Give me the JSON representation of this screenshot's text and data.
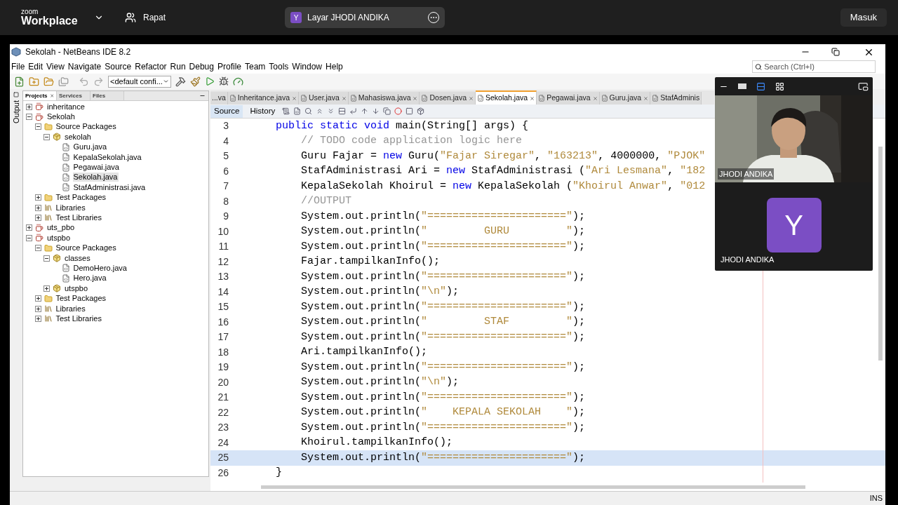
{
  "zoom_bar": {
    "brand_top": "zoom",
    "brand": "Workplace",
    "meetings_label": "Rapat",
    "share_badge": "Y",
    "share_title": "Layar JHODI ANDIKA",
    "sign_in": "Masuk"
  },
  "window": {
    "title": "Sekolah - NetBeans IDE 8.2"
  },
  "menu": [
    "File",
    "Edit",
    "View",
    "Navigate",
    "Source",
    "Refactor",
    "Run",
    "Debug",
    "Profile",
    "Team",
    "Tools",
    "Window",
    "Help"
  ],
  "toolbar": {
    "config": "<default confi..."
  },
  "search": {
    "placeholder": "Search (Ctrl+I)"
  },
  "side_strip": {
    "label": "Output"
  },
  "panel_tabs": [
    {
      "label": "Projects",
      "selected": true
    },
    {
      "label": "Services",
      "selected": false
    },
    {
      "label": "Files",
      "selected": false
    }
  ],
  "tree": [
    {
      "label": "inheritance",
      "kind": "project",
      "expanded": false,
      "selected": false
    },
    {
      "label": "Sekolah",
      "kind": "project",
      "expanded": true,
      "selected": false,
      "children": [
        {
          "label": "Source Packages",
          "kind": "source",
          "expanded": true,
          "selected": false,
          "children": [
            {
              "label": "sekolah",
              "kind": "package",
              "expanded": true,
              "selected": false,
              "children": [
                {
                  "label": "Guru.java",
                  "kind": "file",
                  "selected": false
                },
                {
                  "label": "KepalaSekolah.java",
                  "kind": "file",
                  "selected": false
                },
                {
                  "label": "Pegawai.java",
                  "kind": "file",
                  "selected": false
                },
                {
                  "label": "Sekolah.java",
                  "kind": "file",
                  "selected": true
                },
                {
                  "label": "StafAdministrasi.java",
                  "kind": "file",
                  "selected": false
                }
              ]
            }
          ]
        },
        {
          "label": "Test Packages",
          "kind": "source",
          "expanded": false,
          "selected": false
        },
        {
          "label": "Libraries",
          "kind": "library",
          "expanded": false,
          "selected": false
        },
        {
          "label": "Test Libraries",
          "kind": "library",
          "expanded": false,
          "selected": false
        }
      ]
    },
    {
      "label": "uts_pbo",
      "kind": "project",
      "expanded": false,
      "selected": false
    },
    {
      "label": "utspbo",
      "kind": "project",
      "expanded": true,
      "selected": false,
      "children": [
        {
          "label": "Source Packages",
          "kind": "source",
          "expanded": true,
          "selected": false,
          "children": [
            {
              "label": "classes",
              "kind": "package",
              "expanded": true,
              "selected": false,
              "children": [
                {
                  "label": "DemoHero.java",
                  "kind": "file",
                  "selected": false
                },
                {
                  "label": "Hero.java",
                  "kind": "file",
                  "selected": false
                }
              ]
            },
            {
              "label": "utspbo",
              "kind": "package",
              "expanded": false,
              "selected": false
            }
          ]
        },
        {
          "label": "Test Packages",
          "kind": "source",
          "expanded": false,
          "selected": false
        },
        {
          "label": "Libraries",
          "kind": "library",
          "expanded": false,
          "selected": false
        },
        {
          "label": "Test Libraries",
          "kind": "library",
          "expanded": false,
          "selected": false
        }
      ]
    }
  ],
  "editor_tabs": [
    {
      "label": "...va",
      "kind": "partial",
      "selected": false
    },
    {
      "label": "Inheritance.java",
      "kind": "file",
      "selected": false
    },
    {
      "label": "User.java",
      "kind": "file",
      "selected": false
    },
    {
      "label": "Mahasiswa.java",
      "kind": "file",
      "selected": false
    },
    {
      "label": "Dosen.java",
      "kind": "file",
      "selected": false
    },
    {
      "label": "Sekolah.java",
      "kind": "file",
      "selected": true
    },
    {
      "label": "Pegawai.java",
      "kind": "file",
      "selected": false
    },
    {
      "label": "Guru.java",
      "kind": "file",
      "selected": false
    },
    {
      "label": "StafAdminis",
      "kind": "cut",
      "selected": false
    }
  ],
  "view_tabs": [
    {
      "label": "Source",
      "selected": true
    },
    {
      "label": "History",
      "selected": false
    }
  ],
  "code": [
    {
      "number": "3",
      "current": false,
      "tokens": [
        {
          "kind": "keyword",
          "text": "    public static void"
        },
        {
          "kind": "plain",
          "text": " main(String[] args) {"
        }
      ]
    },
    {
      "number": "4",
      "current": false,
      "tokens": [
        {
          "kind": "comment",
          "text": "        // TODO code application logic here"
        }
      ]
    },
    {
      "number": "5",
      "current": false,
      "tokens": [
        {
          "kind": "plain",
          "text": "        Guru Fajar = "
        },
        {
          "kind": "keyword",
          "text": "new"
        },
        {
          "kind": "plain",
          "text": " Guru("
        },
        {
          "kind": "string",
          "text": "\"Fajar Siregar\""
        },
        {
          "kind": "plain",
          "text": ", "
        },
        {
          "kind": "string",
          "text": "\"163213\""
        },
        {
          "kind": "plain",
          "text": ", 4000000, "
        },
        {
          "kind": "string",
          "text": "\"PJOK\""
        }
      ]
    },
    {
      "number": "6",
      "current": false,
      "tokens": [
        {
          "kind": "plain",
          "text": "        StafAdministrasi Ari = "
        },
        {
          "kind": "keyword",
          "text": "new"
        },
        {
          "kind": "plain",
          "text": " StafAdministrasi ("
        },
        {
          "kind": "string",
          "text": "\"Ari Lesmana\""
        },
        {
          "kind": "plain",
          "text": ", "
        },
        {
          "kind": "string",
          "text": "\"182"
        }
      ]
    },
    {
      "number": "7",
      "current": false,
      "tokens": [
        {
          "kind": "plain",
          "text": "        KepalaSekolah Khoirul = "
        },
        {
          "kind": "keyword",
          "text": "new"
        },
        {
          "kind": "plain",
          "text": " KepalaSekolah ("
        },
        {
          "kind": "string",
          "text": "\"Khoirul Anwar\""
        },
        {
          "kind": "plain",
          "text": ", "
        },
        {
          "kind": "string",
          "text": "\"012"
        }
      ]
    },
    {
      "number": "8",
      "current": false,
      "tokens": [
        {
          "kind": "comment",
          "text": "        //OUTPUT"
        }
      ]
    },
    {
      "number": "9",
      "current": false,
      "tokens": [
        {
          "kind": "plain",
          "text": "        System.out.println("
        },
        {
          "kind": "string",
          "text": "\"======================\""
        },
        {
          "kind": "plain",
          "text": ");"
        }
      ]
    },
    {
      "number": "10",
      "current": false,
      "tokens": [
        {
          "kind": "plain",
          "text": "        System.out.println("
        },
        {
          "kind": "string",
          "text": "\"         GURU         \""
        },
        {
          "kind": "plain",
          "text": ");"
        }
      ]
    },
    {
      "number": "11",
      "current": false,
      "tokens": [
        {
          "kind": "plain",
          "text": "        System.out.println("
        },
        {
          "kind": "string",
          "text": "\"======================\""
        },
        {
          "kind": "plain",
          "text": ");"
        }
      ]
    },
    {
      "number": "12",
      "current": false,
      "tokens": [
        {
          "kind": "plain",
          "text": "        Fajar.tampilkanInfo();"
        }
      ]
    },
    {
      "number": "13",
      "current": false,
      "tokens": [
        {
          "kind": "plain",
          "text": "        System.out.println("
        },
        {
          "kind": "string",
          "text": "\"======================\""
        },
        {
          "kind": "plain",
          "text": ");"
        }
      ]
    },
    {
      "number": "14",
      "current": false,
      "tokens": [
        {
          "kind": "plain",
          "text": "        System.out.println("
        },
        {
          "kind": "string",
          "text": "\"\\n\""
        },
        {
          "kind": "plain",
          "text": ");"
        }
      ]
    },
    {
      "number": "15",
      "current": false,
      "tokens": [
        {
          "kind": "plain",
          "text": "        System.out.println("
        },
        {
          "kind": "string",
          "text": "\"======================\""
        },
        {
          "kind": "plain",
          "text": ");"
        }
      ]
    },
    {
      "number": "16",
      "current": false,
      "tokens": [
        {
          "kind": "plain",
          "text": "        System.out.println("
        },
        {
          "kind": "string",
          "text": "\"         STAF         \""
        },
        {
          "kind": "plain",
          "text": ");"
        }
      ]
    },
    {
      "number": "17",
      "current": false,
      "tokens": [
        {
          "kind": "plain",
          "text": "        System.out.println("
        },
        {
          "kind": "string",
          "text": "\"======================\""
        },
        {
          "kind": "plain",
          "text": ");"
        }
      ]
    },
    {
      "number": "18",
      "current": false,
      "tokens": [
        {
          "kind": "plain",
          "text": "        Ari.tampilkanInfo();"
        }
      ]
    },
    {
      "number": "19",
      "current": false,
      "tokens": [
        {
          "kind": "plain",
          "text": "        System.out.println("
        },
        {
          "kind": "string",
          "text": "\"======================\""
        },
        {
          "kind": "plain",
          "text": ");"
        }
      ]
    },
    {
      "number": "20",
      "current": false,
      "tokens": [
        {
          "kind": "plain",
          "text": "        System.out.println("
        },
        {
          "kind": "string",
          "text": "\"\\n\""
        },
        {
          "kind": "plain",
          "text": ");"
        }
      ]
    },
    {
      "number": "21",
      "current": false,
      "tokens": [
        {
          "kind": "plain",
          "text": "        System.out.println("
        },
        {
          "kind": "string",
          "text": "\"======================\""
        },
        {
          "kind": "plain",
          "text": ");"
        }
      ]
    },
    {
      "number": "22",
      "current": false,
      "tokens": [
        {
          "kind": "plain",
          "text": "        System.out.println("
        },
        {
          "kind": "string",
          "text": "\"    KEPALA SEKOLAH    \""
        },
        {
          "kind": "plain",
          "text": ");"
        }
      ]
    },
    {
      "number": "23",
      "current": false,
      "tokens": [
        {
          "kind": "plain",
          "text": "        System.out.println("
        },
        {
          "kind": "string",
          "text": "\"======================\""
        },
        {
          "kind": "plain",
          "text": ");"
        }
      ]
    },
    {
      "number": "24",
      "current": false,
      "tokens": [
        {
          "kind": "plain",
          "text": "        Khoirul.tampilkanInfo();"
        }
      ]
    },
    {
      "number": "25",
      "current": true,
      "tokens": [
        {
          "kind": "plain",
          "text": "        System.out.println("
        },
        {
          "kind": "string",
          "text": "\"======================\""
        },
        {
          "kind": "plain",
          "text": ");"
        }
      ]
    },
    {
      "number": "26",
      "current": false,
      "tokens": [
        {
          "kind": "plain",
          "text": "    }"
        }
      ]
    }
  ],
  "video": [
    {
      "kind": "camera",
      "name": "JHODI ANDIKA"
    },
    {
      "kind": "avatar",
      "name": "JHODI ANDIKA",
      "initial": "Y"
    }
  ],
  "status": {
    "mode": "INS"
  }
}
